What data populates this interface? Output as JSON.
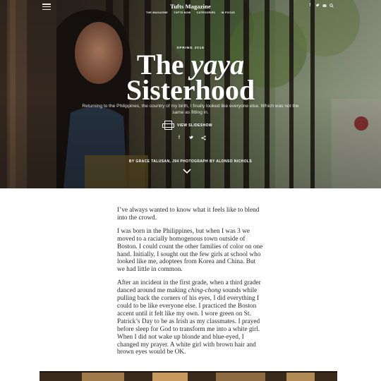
{
  "header": {
    "brand": "Tufts Magazine",
    "nav": [
      "THE MAGAZINE",
      "TUFTS NOW",
      "CATEGORIES",
      "IN FOCUS"
    ],
    "social_icons": [
      "facebook-icon",
      "twitter-icon",
      "email-icon",
      "search-icon"
    ]
  },
  "hero": {
    "kicker": "SPRING 2016",
    "title_the": "The",
    "title_yaya": "yaya",
    "title_line2": "Sisterhood",
    "subtitle": "Returning to the Philippines, the country of my birth, I finally looked like everyone else. Which was not the same as fitting in.",
    "slideshow_label": "VIEW SLIDESHOW",
    "share_icons": [
      "facebook-icon",
      "twitter-icon",
      "share-icon"
    ],
    "byline": "BY GRACE TALUSAN, J94  PHOTOGRAPH BY ALONSO NICHOLS"
  },
  "article": {
    "p1": "I’ve always wanted to know what it feels like to blend into the crowd.",
    "p2": "I was born in the Philippines, but when I was 3 we moved to a racially homogenous town outside of Boston. I could count the other families of color on one hand. Initially, I sought out the few girls at school who looked like me, adoptees from Korea and China. But we had little in common.",
    "p3_a": "After an incident in the first grade, when a third grader danced around me making ",
    "p3_em": "ching-chong",
    "p3_b": " sounds while pulling back the corners of his eyes, I did everything I could to be like everyone else. I practiced the Boston accent until it felt like my own. I wore green on St. Patrick’s Day to be as Irish as my classmates. I prayed before sleep for God to transform me into a white girl. When I did not wake up blonde and blue-eyed, I changed my prayer. A white girl with brown hair and brown eyes would be OK."
  }
}
